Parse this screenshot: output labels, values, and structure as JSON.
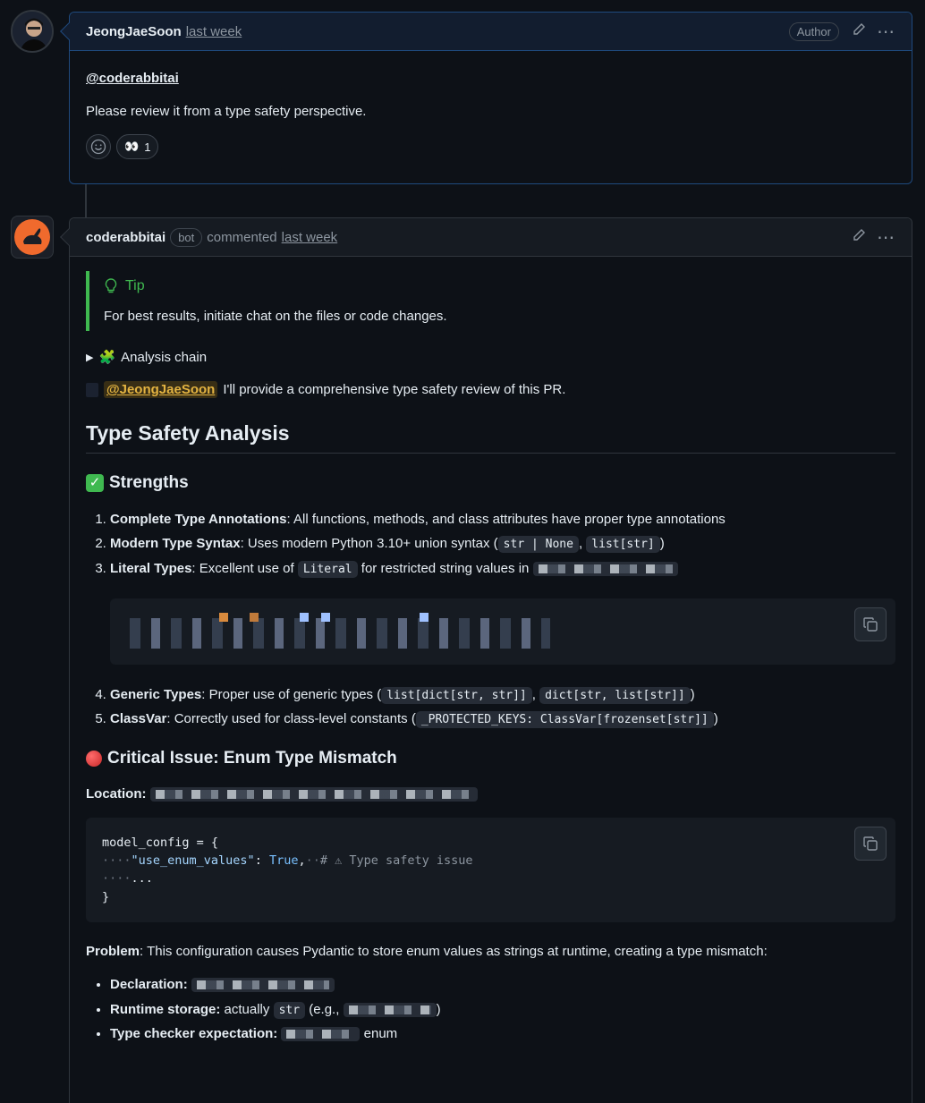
{
  "comment1": {
    "author": "JeongJaeSoon",
    "timestamp": "last week",
    "author_badge": "Author",
    "mention": "@coderabbitai",
    "text": "Please review it from a type safety perspective.",
    "reaction_eyes_count": "1"
  },
  "comment2": {
    "author": "coderabbitai",
    "bot_badge": "bot",
    "verb": "commented",
    "timestamp": "last week",
    "tip_title": "Tip",
    "tip_text": "For best results, initiate chat on the files or code changes.",
    "analysis_chain": "Analysis chain",
    "mention": "@JeongJaeSoon",
    "intro": "I'll provide a comprehensive type safety review of this PR.",
    "heading": "Type Safety Analysis",
    "strengths_heading": "Strengths",
    "strengths": [
      {
        "label": "Complete Type Annotations",
        "text": ": All functions, methods, and class attributes have proper type annotations"
      },
      {
        "label": "Modern Type Syntax",
        "text": ": Uses modern Python 3.10+ union syntax (",
        "code1": "str | None",
        "code2": "list[str]",
        "end": ")"
      },
      {
        "label": "Literal Types",
        "text": ": Excellent use of ",
        "code1": "Literal",
        "text2": " for restricted string values in"
      },
      {
        "label": "Generic Types",
        "text": ": Proper use of generic types (",
        "code1": "list[dict[str, str]]",
        "code2": "dict[str, list[str]]",
        "end": ")"
      },
      {
        "label": "ClassVar",
        "text": ": Correctly used for class-level constants (",
        "code1": "_PROTECTED_KEYS: ClassVar[frozenset[str]]",
        "end": ")"
      }
    ],
    "critical_heading": "Critical Issue: Enum Type Mismatch",
    "location_label": "Location:",
    "code": {
      "line1": "model_config = {",
      "line2_key": "\"use_enum_values\"",
      "line2_val": "True",
      "line2_comment": "# ⚠ Type safety issue",
      "line3": "...",
      "line4": "}"
    },
    "problem_label": "Problem",
    "problem_text": ": This configuration causes Pydantic to store enum values as strings at runtime, creating a type mismatch:",
    "bullets": [
      {
        "label": "Declaration:"
      },
      {
        "label": "Runtime storage:",
        "text": " actually ",
        "code": "str",
        "text2": " (e.g., ",
        "end": ")"
      },
      {
        "label": "Type checker expectation:",
        "end": " enum"
      }
    ]
  },
  "colors": {
    "background": "#0d1117",
    "tip_accent": "#3fb950",
    "mention_bg": "#382e15",
    "mention_fg": "#e3b341",
    "highlight_border": "#1f4a7e"
  }
}
